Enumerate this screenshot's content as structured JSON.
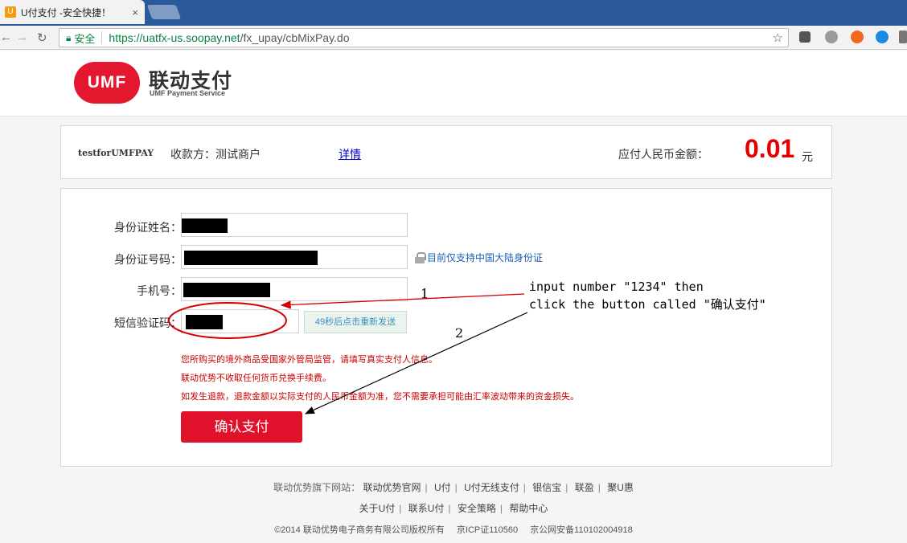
{
  "browser": {
    "tab_title": "U付支付 -安全快捷！",
    "tab_close": "×",
    "secure_label": "安全",
    "url_scheme_host": "https://uatfx-us.soopay.net",
    "url_path": "/fx_upay/cbMixPay.do"
  },
  "brand": {
    "logo_mark": "UMF",
    "name_cn": "联动支付",
    "name_en": "UMF Payment Service",
    "color": "#e3172d"
  },
  "merchant": {
    "id": "testforUMFPAY",
    "payee": "收款方：测试商户",
    "detail_link": "详情",
    "amount_label": "应付人民币金额：",
    "amount": "0.01",
    "currency_unit": "元"
  },
  "form": {
    "name_label": "身份证姓名：",
    "id_label": "身份证号码：",
    "id_tip": "目前仅支持中国大陆身份证",
    "phone_label": "手机号：",
    "sms_label": "短信验证码：",
    "resend_label": "49秒后点击重新发送",
    "notices": [
      "您所购买的境外商品受国家外管局监管，请填写真实支付人信息。",
      "联动优势不收取任何货币兑换手续费。",
      "如发生退款，退款金额以实际支付的人民币金额为准，您不需要承担可能由汇率波动带来的资金损失。"
    ],
    "confirm_label": "确认支付"
  },
  "annotations": {
    "line1": "input number \"1234\" then",
    "line2": "click the button called \"确认支付\"",
    "step1": "1",
    "step2": "2",
    "color": "#d40000"
  },
  "footer": {
    "sites_lead": "联动优势旗下网站：",
    "sites": [
      "联动优势官网",
      "U付",
      "U付无线支付",
      "银信宝",
      "联盈",
      "聚U惠"
    ],
    "links": [
      "关于U付",
      "联系U付",
      "安全策略",
      "帮助中心"
    ],
    "copyright": "©2014 联动优势电子商务有限公司版权所有",
    "icp": "京ICP证110560",
    "police": "京公网安备110102004918"
  }
}
